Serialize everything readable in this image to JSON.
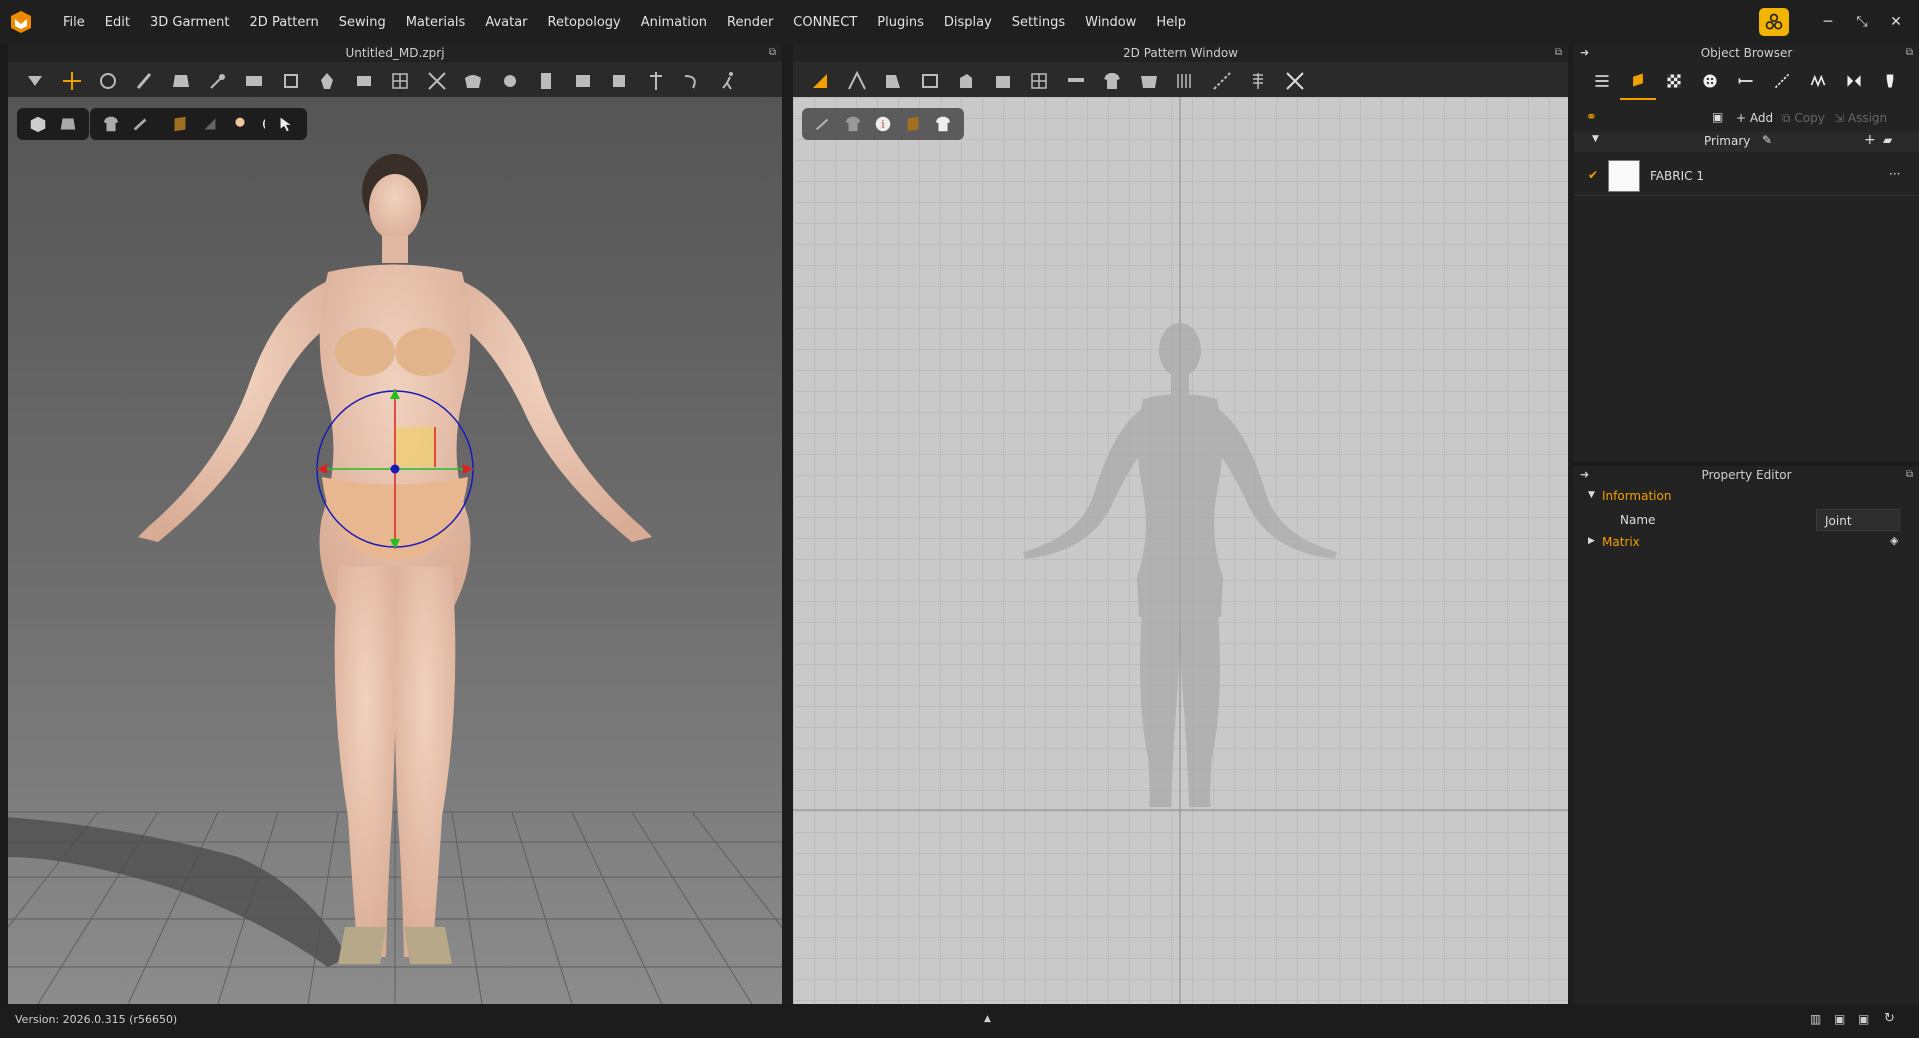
{
  "menu": [
    "File",
    "Edit",
    "3D Garment",
    "2D Pattern",
    "Sewing",
    "Materials",
    "Avatar",
    "Retopology",
    "Animation",
    "Render",
    "CONNECT",
    "Plugins",
    "Display",
    "Settings",
    "Window",
    "Help"
  ],
  "window_controls": {
    "minimize": "─",
    "restore": "⤡",
    "close": "✕"
  },
  "view3d": {
    "title": "Untitled_MD.zprj"
  },
  "view2d": {
    "title": "2D Pattern Window"
  },
  "object_browser": {
    "title": "Object Browser",
    "actions": {
      "add": "+ Add",
      "copy": "Copy",
      "assign": "Assign"
    },
    "group": "Primary",
    "fabric": {
      "name": "FABRIC 1",
      "more": "···"
    }
  },
  "property_editor": {
    "title": "Property Editor",
    "information": "Information",
    "name_label": "Name",
    "name_value": "Joint",
    "matrix": "Matrix"
  },
  "status": {
    "version": "Version: 2026.0.315 (r56650)",
    "center_arrow": "▲"
  },
  "colors": {
    "accent": "#f2a000",
    "gizmo_ring": "#1a1ab8",
    "axis_x": "#e02020",
    "axis_y": "#20c020"
  }
}
